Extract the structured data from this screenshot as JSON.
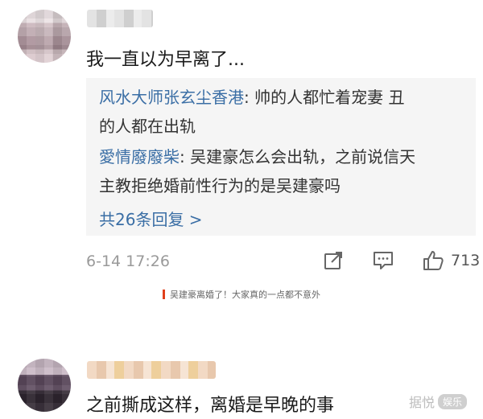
{
  "comments": [
    {
      "text": "我一直以为早离了...",
      "replies": [
        {
          "name": "风水大师张玄尘香港",
          "sep": ": ",
          "line1": "帅的人都忙着宠妻 丑",
          "line2": "的人都在出轨"
        },
        {
          "name": "愛情廢廢柴",
          "sep": ":  ",
          "line1": "吴建豪怎么会出轨，之前说信天",
          "line2": "主教拒绝婚前性行为的是吴建豪吗"
        }
      ],
      "more_replies": "共26条回复 >",
      "time": "6-14 17:26",
      "actions": {
        "share_icon": "share-icon",
        "comment_icon": "comment-icon",
        "like_icon": "thumbs-up-icon",
        "like_count": "713"
      }
    },
    {
      "text": "之前撕成这样，离婚是早晚的事"
    }
  ],
  "caption": "吴建豪离婚了！大家真的一点都不意外",
  "watermark": {
    "text": "据悦",
    "badge": "娱乐"
  },
  "colors": {
    "link": "#3a6ea5",
    "accent": "#e0401c",
    "reply_bg": "#f5f5f5"
  }
}
